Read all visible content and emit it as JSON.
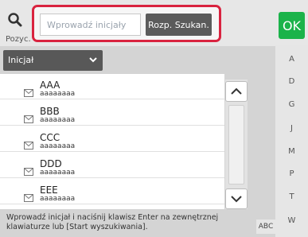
{
  "header": {
    "position_label": "Pozyc.",
    "search_placeholder": "Wprowadź inicjały",
    "search_button_label": "Rozp. Szukan.",
    "ok_label": "OK"
  },
  "filter": {
    "selected": "Inicjał"
  },
  "list": {
    "items": [
      {
        "name": "AAA",
        "sub": "aaaaaaaa"
      },
      {
        "name": "BBB",
        "sub": "aaaaaaaa"
      },
      {
        "name": "CCC",
        "sub": "aaaaaaaa"
      },
      {
        "name": "DDD",
        "sub": "aaaaaaaa"
      },
      {
        "name": "EEE",
        "sub": "aaaaaaaa"
      }
    ]
  },
  "alphabet": [
    "A",
    "D",
    "G",
    "J",
    "M",
    "P",
    "T",
    "W"
  ],
  "footer": {
    "hint": "Wprowadź inicjał i naciśnij klawisz Enter na zewnętrznej klawiaturze lub [Start wyszukiwania].",
    "abc_label": "ABC"
  },
  "colors": {
    "highlight_border": "#d9233f",
    "ok_green": "#1bb34a",
    "dark_button": "#5b5b5b"
  }
}
